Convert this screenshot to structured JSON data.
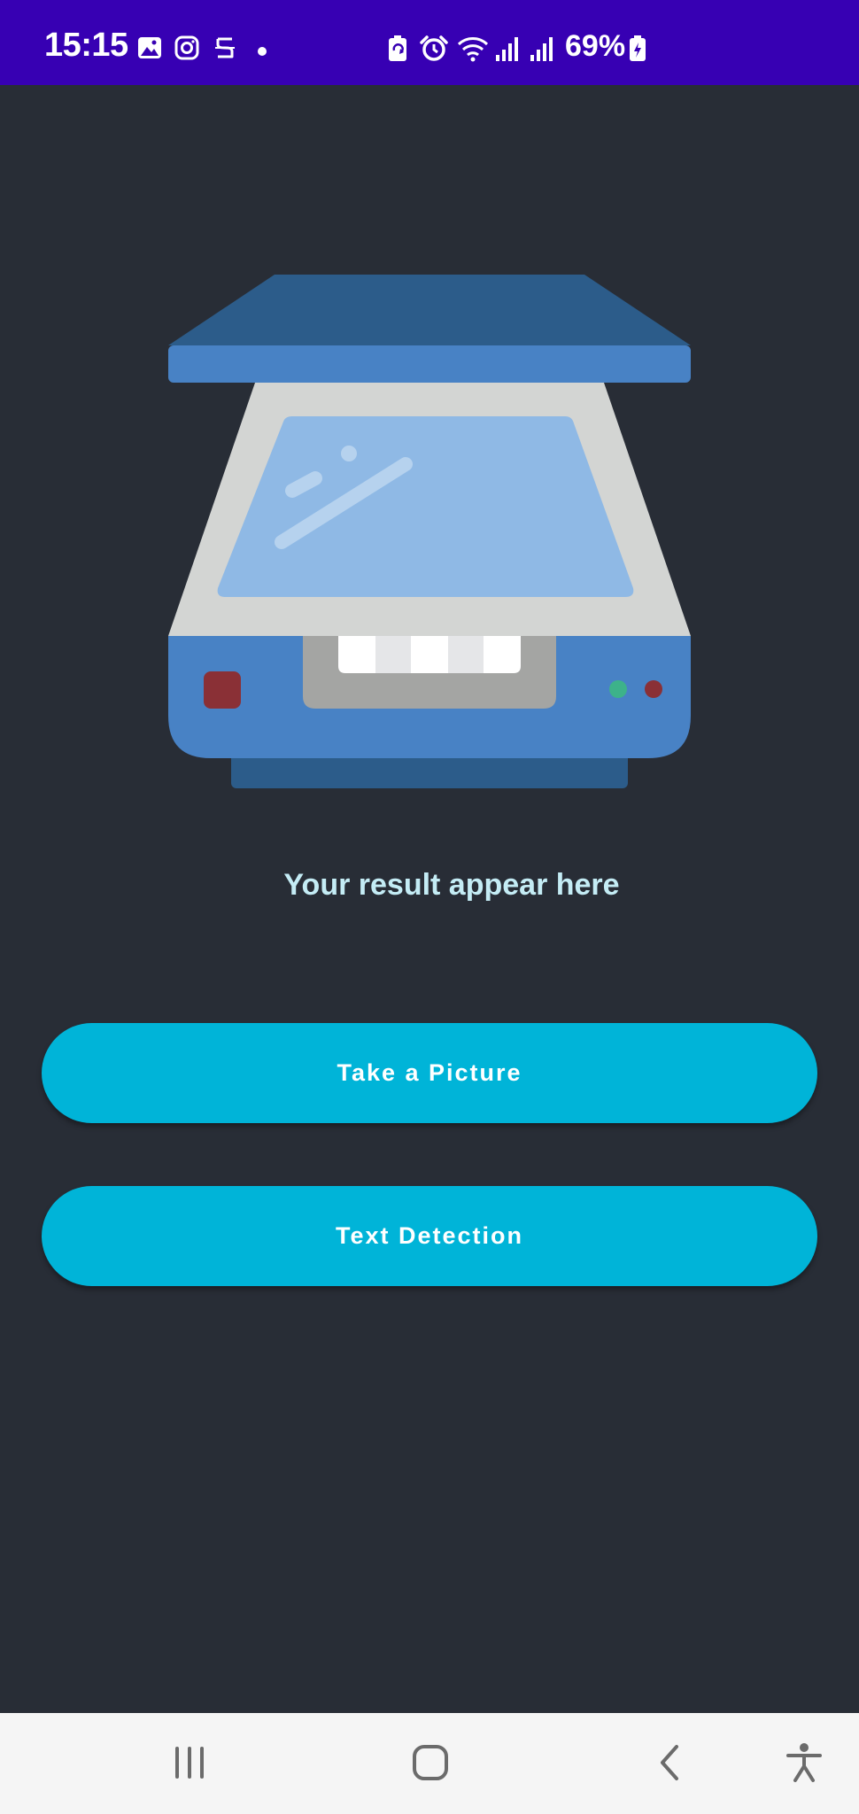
{
  "status_bar": {
    "time": "15:15",
    "battery": "69%",
    "left_icons": [
      "gallery-icon",
      "instagram-icon",
      "app-notification-icon",
      "dot-icon"
    ],
    "right_icons": [
      "battery-saver-icon",
      "alarm-icon",
      "wifi-icon",
      "signal-icon",
      "signal-icon",
      "battery-charging-icon"
    ]
  },
  "main": {
    "illustration": "scanner-icon",
    "result_text": "Your result appear here",
    "buttons": {
      "take_picture": "Take a Picture",
      "text_detection": "Text Detection"
    }
  },
  "nav_bar": {
    "items": [
      "recent-apps-icon",
      "home-icon",
      "back-icon",
      "accessibility-icon"
    ]
  },
  "colors": {
    "status_bar": "#3700b3",
    "background": "#282d36",
    "button": "#00b4d8",
    "result_text": "#c4ecf5",
    "nav_bar": "#f5f5f5"
  }
}
